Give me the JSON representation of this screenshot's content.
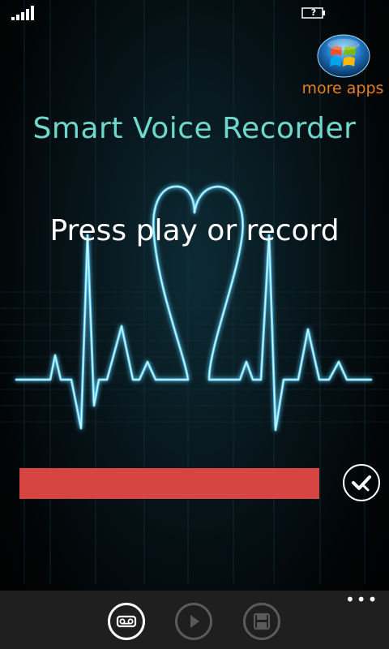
{
  "status_bar": {
    "signal_icon": "signal-strength-icon",
    "battery_label": "?"
  },
  "more_apps": {
    "icon": "windows-logo-icon",
    "label": "more apps"
  },
  "app_title": "Smart Voice Recorder",
  "status_text": "Press play or record",
  "progress": {
    "fraction": 1.0,
    "color": "#d64541"
  },
  "confirm_button": {
    "icon": "check-circle-icon"
  },
  "app_bar": {
    "buttons": [
      {
        "icon": "voicemail-icon",
        "enabled": true
      },
      {
        "icon": "play-icon",
        "enabled": false
      },
      {
        "icon": "save-icon",
        "enabled": false
      }
    ],
    "more_label": "•••"
  },
  "colors": {
    "title": "#6fd8cc",
    "more_apps_label": "#e67e22",
    "wave_glow": "#5fd4ff",
    "app_bar_bg": "#1f1f1f"
  }
}
